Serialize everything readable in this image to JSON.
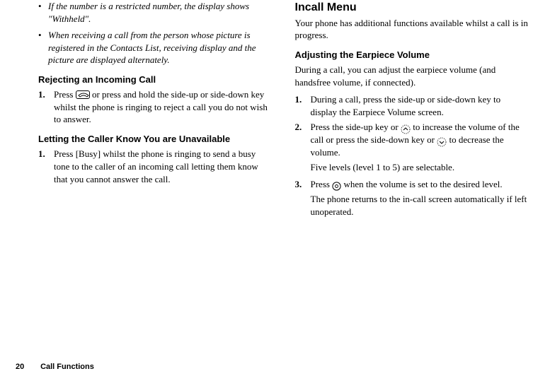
{
  "left": {
    "bullets": [
      "If the number is a restricted number, the display shows \"Withheld\".",
      "When receiving a call from the person whose picture is registered in the Contacts List, receiving display and the picture are displayed alternately."
    ],
    "rejecting": {
      "heading": "Rejecting an Incoming Call",
      "step1_num": "1.",
      "step1_a": "Press ",
      "step1_b": " or press and hold the side-up or side-down key whilst the phone is ringing to reject a call you do not wish to answer."
    },
    "letting": {
      "heading": "Letting the Caller Know You are Unavailable",
      "step1_num": "1.",
      "step1": "Press [Busy] whilst the phone is ringing to send a busy tone to the caller of an incoming call letting them know that you cannot answer the call."
    }
  },
  "right": {
    "incall_title": "Incall Menu",
    "incall_intro": "Your phone has additional functions available whilst a call is in progress.",
    "adjusting": {
      "heading": "Adjusting the Earpiece Volume",
      "intro": "During a call, you can adjust the earpiece volume (and handsfree volume, if connected).",
      "step1_num": "1.",
      "step1": "During a call, press the side-up or side-down key to display the Earpiece Volume screen.",
      "step2_num": "2.",
      "step2_a": "Press the side-up key or ",
      "step2_b": " to increase the volume of the call or press the side-down key or ",
      "step2_c": " to decrease the volume.",
      "step2_note": "Five levels (level 1 to 5) are selectable.",
      "step3_num": "3.",
      "step3_a": "Press ",
      "step3_b": " when the volume is set to the desired level.",
      "step3_note": "The phone returns to the in-call screen automatically if left unoperated."
    }
  },
  "footer": {
    "page": "20",
    "section": "Call Functions"
  }
}
